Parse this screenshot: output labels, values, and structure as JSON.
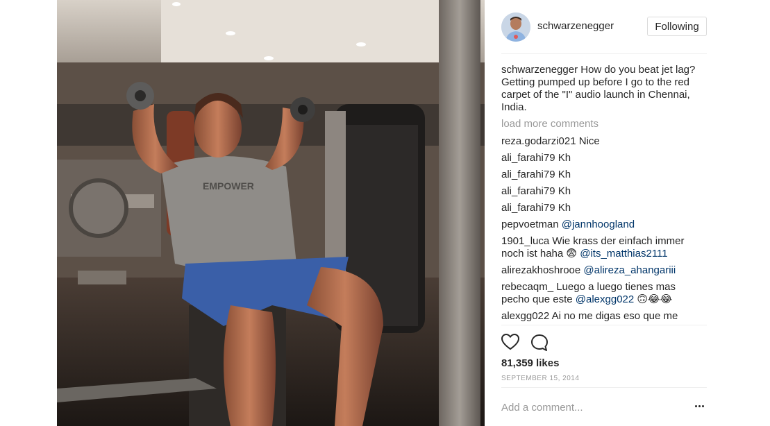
{
  "post": {
    "username": "schwarzenegger",
    "follow_label": "Following",
    "caption_user": "schwarzenegger",
    "caption_text": "How do you beat jet lag? Getting pumped up before I go to the red carpet of the \"I\" audio launch in Chennai, India.",
    "load_more": "load more comments",
    "likes": "81,359 likes",
    "date": "SEPTEMBER 15, 2014",
    "add_comment_placeholder": "Add a comment...",
    "shirt_text": "EMPOWER"
  },
  "comments": [
    {
      "user": "reza.godarzi021",
      "text": "Nice",
      "mention": "",
      "emoji": ""
    },
    {
      "user": "ali_farahi79",
      "text": "Kh",
      "mention": "",
      "emoji": ""
    },
    {
      "user": "ali_farahi79",
      "text": "Kh",
      "mention": "",
      "emoji": ""
    },
    {
      "user": "ali_farahi79",
      "text": "Kh",
      "mention": "",
      "emoji": ""
    },
    {
      "user": "ali_farahi79",
      "text": "Kh",
      "mention": "",
      "emoji": ""
    },
    {
      "user": "pepvoetman",
      "text": "",
      "mention": "@jannhoogland",
      "emoji": ""
    },
    {
      "user": "1901_luca",
      "text": "Wie krass der einfach immer noch ist haha 😨",
      "mention": "@its_matthias2111",
      "emoji": ""
    },
    {
      "user": "alirezakhoshrooe",
      "text": "",
      "mention": "@alireza_ahangariii",
      "emoji": ""
    },
    {
      "user": "rebecaqm_",
      "text": "Luego a luego tienes mas pecho que este",
      "mention": "@alexgg022",
      "emoji": "🙃😂😂"
    },
    {
      "user": "alexgg022",
      "text": "Ai no me digas eso que me",
      "mention": "",
      "emoji": ""
    }
  ],
  "colors": {
    "link": "#003569",
    "muted": "#999999",
    "border": "#efefef"
  },
  "icons": {
    "like": "heart-icon",
    "comment": "comment-bubble-icon",
    "more": "ellipsis-icon"
  }
}
